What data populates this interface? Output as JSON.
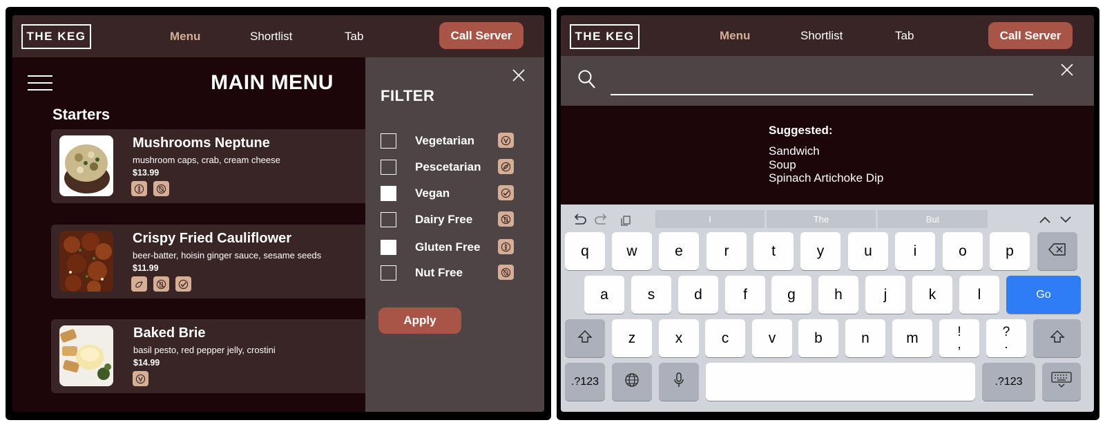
{
  "brand": {
    "logo": "THE KEG"
  },
  "nav": {
    "menu": "Menu",
    "shortlist": "Shortlist",
    "tab": "Tab",
    "call_server": "Call Server"
  },
  "menu": {
    "title": "MAIN MENU",
    "section": "Starters",
    "items": [
      {
        "name": "Mushrooms Neptune",
        "desc": "mushroom caps, crab, cream cheese",
        "price": "$13.99",
        "badges": [
          "gluten-free-icon",
          "nut-free-icon"
        ]
      },
      {
        "name": "Crispy Fried Cauliflower",
        "desc": "beer-batter, hoisin ginger sauce, sesame seeds",
        "price": "$11.99",
        "badges": [
          "pescetarian-icon",
          "dairy-free-icon",
          "vegan-icon"
        ]
      },
      {
        "name": "Baked Brie",
        "desc": "basil pesto, red pepper jelly, crostini",
        "price": "$14.99",
        "badges": [
          "vegetarian-icon"
        ]
      }
    ]
  },
  "filter": {
    "title": "FILTER",
    "apply": "Apply",
    "options": [
      {
        "label": "Vegetarian",
        "checked": false,
        "icon": "vegetarian-icon"
      },
      {
        "label": "Pescetarian",
        "checked": false,
        "icon": "pescetarian-icon"
      },
      {
        "label": "Vegan",
        "checked": true,
        "icon": "vegan-icon"
      },
      {
        "label": "Dairy Free",
        "checked": false,
        "icon": "dairy-free-icon"
      },
      {
        "label": "Gluten Free",
        "checked": true,
        "icon": "gluten-free-icon"
      },
      {
        "label": "Nut Free",
        "checked": false,
        "icon": "nut-free-icon"
      }
    ]
  },
  "search": {
    "value": "",
    "suggested_title": "Suggested:",
    "suggestions": [
      "Sandwich",
      "Soup",
      "Spinach Artichoke Dip"
    ]
  },
  "keyboard": {
    "predictions": [
      "I",
      "The",
      "But"
    ],
    "row1": [
      "q",
      "w",
      "e",
      "r",
      "t",
      "y",
      "u",
      "i",
      "o",
      "p"
    ],
    "row2": [
      "a",
      "s",
      "d",
      "f",
      "g",
      "h",
      "j",
      "k",
      "l"
    ],
    "row3": [
      "z",
      "x",
      "c",
      "v",
      "b",
      "n",
      "m"
    ],
    "punct1": [
      "!",
      ","
    ],
    "punct2": [
      "?",
      "."
    ],
    "go": "Go",
    "numbers": ".?123"
  },
  "colors": {
    "accent": "#a85548",
    "tan": "#d6ae96",
    "bg": "#1d060a",
    "panel": "#3a2526",
    "filter_panel": "#4e4446",
    "keyboard_blue": "#2e7cf6"
  }
}
